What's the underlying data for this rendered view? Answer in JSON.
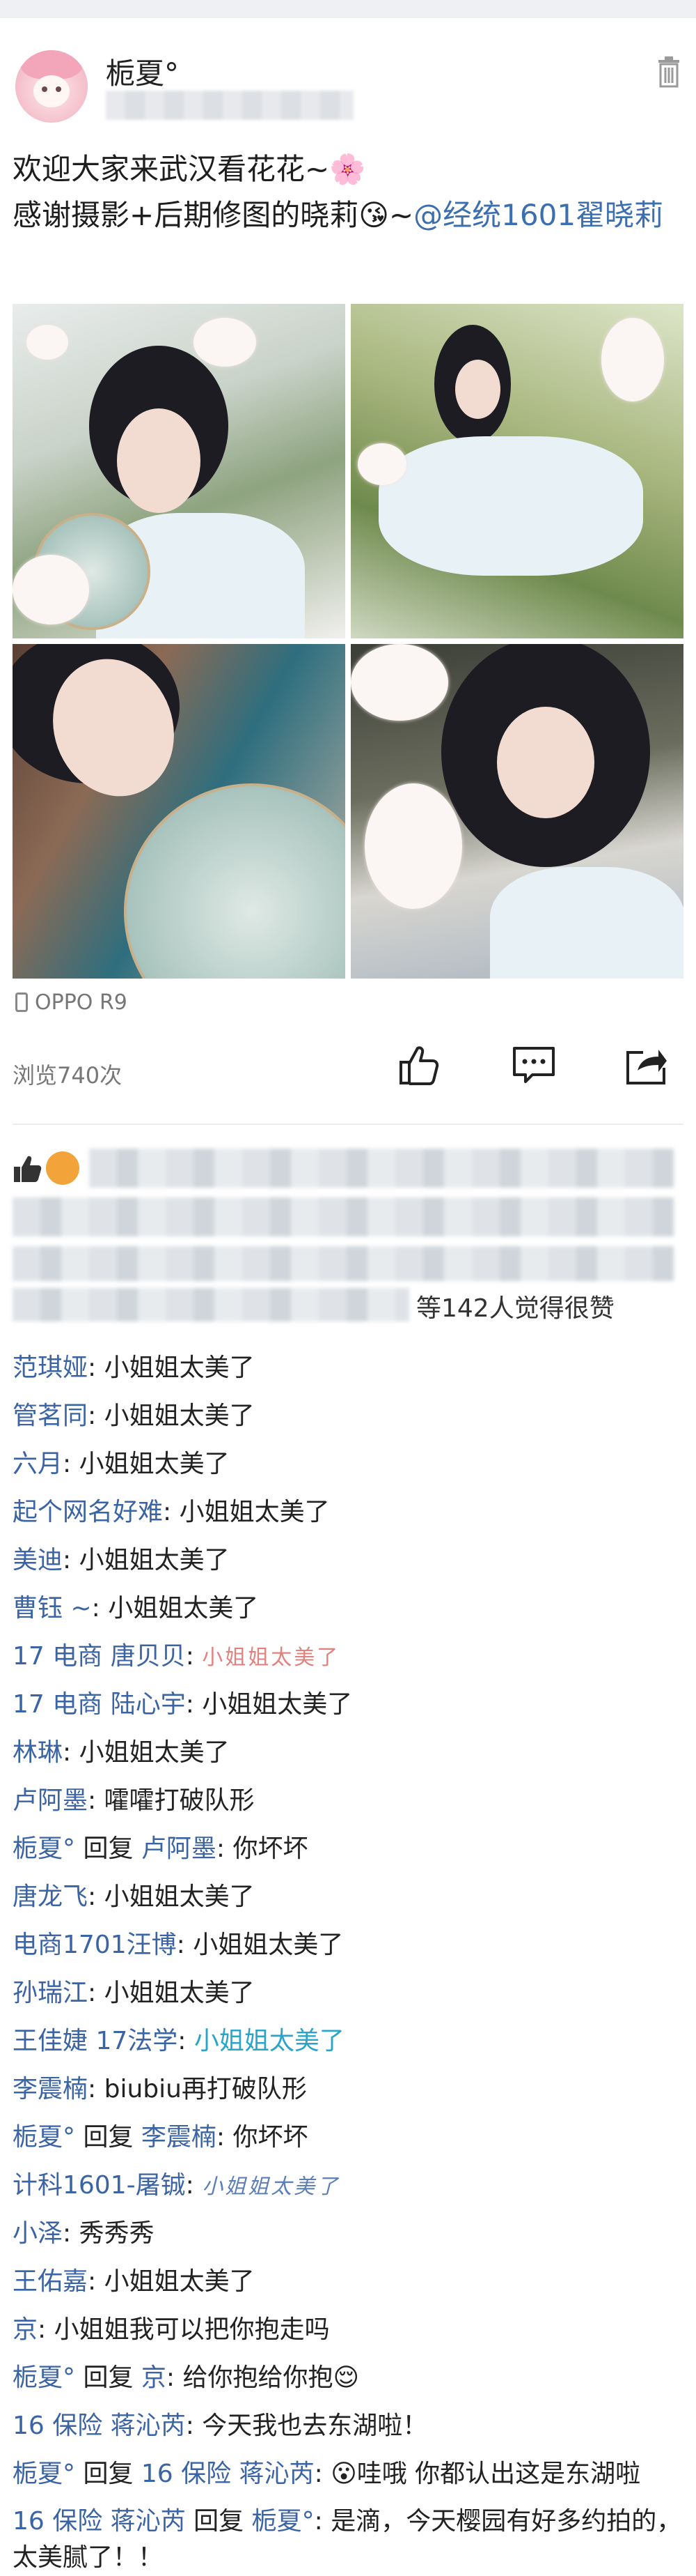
{
  "post": {
    "username": "栀夏°",
    "line1": "欢迎大家来武汉看花花~🌸",
    "line2_prefix": "感谢摄影+后期修图的晓莉😘~",
    "mention": "@经统1601翟晓莉",
    "device": "OPPO R9",
    "views": "浏览740次"
  },
  "likes": {
    "suffix": "等142人觉得很赞"
  },
  "comments": [
    {
      "name": "范琪娅",
      "sep": ": ",
      "text": "小姐姐太美了"
    },
    {
      "name": "管茗同",
      "sep": ": ",
      "text": "小姐姐太美了"
    },
    {
      "name": "六月",
      "sep": ": ",
      "text": "小姐姐太美了"
    },
    {
      "name": "起个网名好难",
      "sep": ": ",
      "text": "小姐姐太美了"
    },
    {
      "name": "美迪",
      "sep": ": ",
      "text": "小姐姐太美了"
    },
    {
      "name": "曹钰 ~",
      "sep": ": ",
      "text": "小姐姐太美了"
    },
    {
      "name": "17 电商 唐贝贝",
      "sep": ": ",
      "text": "小姐姐太美了"
    },
    {
      "name": "17 电商 陆心宇",
      "sep": ": ",
      "text": "小姐姐太美了"
    },
    {
      "name": "林琳",
      "sep": ": ",
      "text": "小姐姐太美了"
    },
    {
      "name": "卢阿墨",
      "sep": ": ",
      "text": "嚯嚯打破队形"
    },
    {
      "name": "栀夏°",
      "mid": " 回复 ",
      "target": "卢阿墨",
      "sep": ": ",
      "text": "你坏坏"
    },
    {
      "name": "唐龙飞",
      "sep": ": ",
      "text": "小姐姐太美了"
    },
    {
      "name": "电商1701汪博",
      "sep": ": ",
      "text": "小姐姐太美了"
    },
    {
      "name": "孙瑞江",
      "sep": ": ",
      "text": "小姐姐太美了"
    },
    {
      "name": "王佳婕 17法学",
      "sep": ": ",
      "text": "小姐姐太美了"
    },
    {
      "name": "李震楠",
      "sep": ": ",
      "text": "biubiu再打破队形"
    },
    {
      "name": "栀夏°",
      "mid": " 回复 ",
      "target": "李震楠",
      "sep": ": ",
      "text": "你坏坏"
    },
    {
      "name": "计科1601-屠铖",
      "sep": ": ",
      "text": "小姐姐太美了"
    },
    {
      "name": "小泽",
      "sep": ": ",
      "text": "秀秀秀"
    },
    {
      "name": "王佑嘉",
      "sep": ": ",
      "text": "小姐姐太美了"
    },
    {
      "name": "京",
      "sep": ": ",
      "text": "小姐姐我可以把你抱走吗"
    },
    {
      "name": "栀夏°",
      "mid": " 回复 ",
      "target": "京",
      "sep": ": ",
      "text": "给你抱给你抱😌"
    },
    {
      "name": "16 保险 蒋沁芮",
      "sep": ": ",
      "text": "今天我也去东湖啦！"
    },
    {
      "name": "栀夏°",
      "mid": " 回复 ",
      "target": "16 保险 蒋沁芮",
      "sep": ": ",
      "text": "😮哇哦 你都认出这是东湖啦"
    },
    {
      "name": "16 保险 蒋沁芮",
      "mid": " 回复 ",
      "target": "栀夏°",
      "sep": ": ",
      "text": "是滴，今天樱园有好多约拍的，太美腻了！！"
    }
  ],
  "colors": {
    "name_link": "#3b64a4",
    "teal_text": "#2aa5c9",
    "handwriting_pink": "#e2827f",
    "handwriting_blue": "#5d7fb8"
  },
  "icons": [
    "trash-icon",
    "thumbs-up-icon",
    "comment-icon",
    "share-icon",
    "phone-icon",
    "like-icon"
  ]
}
